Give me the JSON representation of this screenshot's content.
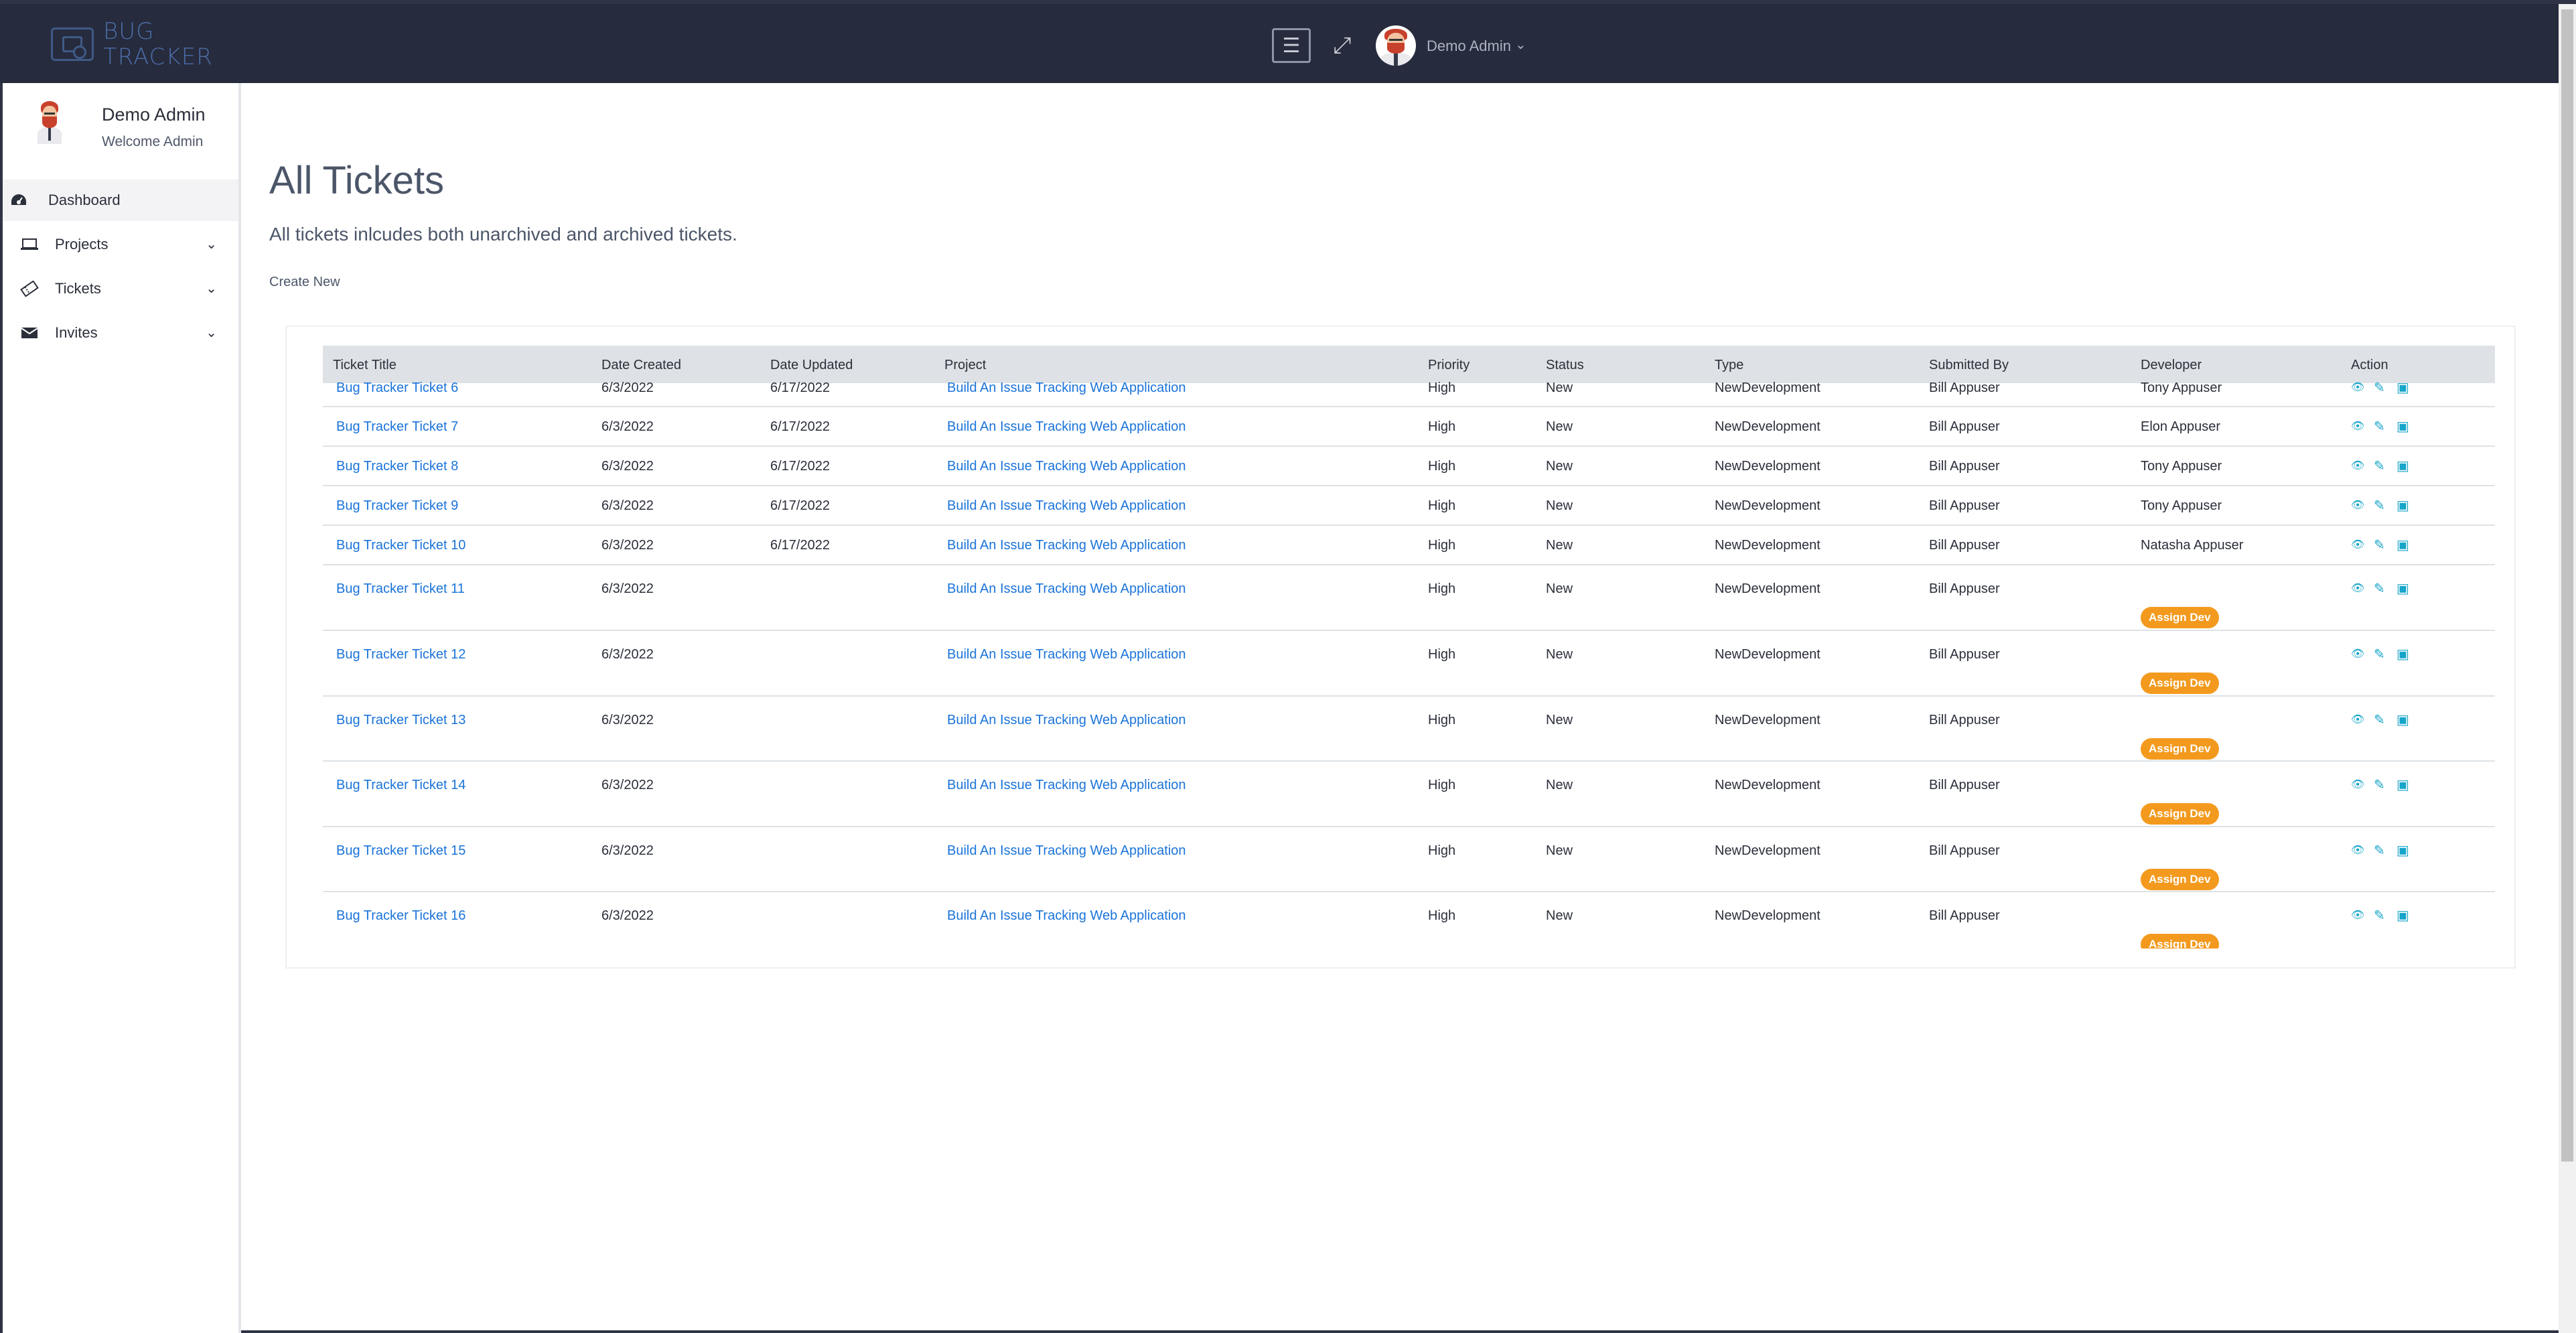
{
  "brand": {
    "line1": "BUG",
    "line2": "TRACKER"
  },
  "topbar": {
    "menu_icon": "hamburger-icon",
    "expand_icon": "expand-icon",
    "user": "Demo Admin",
    "caret": "⌄"
  },
  "sidebar": {
    "user_name": "Demo Admin",
    "welcome": "Welcome Admin",
    "items": [
      {
        "label": "Dashboard",
        "icon": "dashboard-icon",
        "active": true
      },
      {
        "label": "Projects",
        "icon": "laptop-icon"
      },
      {
        "label": "Tickets",
        "icon": "ticket-icon"
      },
      {
        "label": "Invites",
        "icon": "envelope-icon"
      }
    ]
  },
  "main": {
    "title": "All Tickets",
    "subtitle": "All tickets inlcudes both unarchived and archived tickets.",
    "create_new": "Create New"
  },
  "table": {
    "headers": [
      "Ticket Title",
      "Date Created",
      "Date Updated",
      "Project",
      "Priority",
      "Status",
      "Type",
      "Submitted By",
      "Developer",
      "Action"
    ],
    "assign_label": "Assign Dev",
    "rows": [
      {
        "title": "Bug Tracker Ticket 6",
        "created": "6/3/2022",
        "updated": "6/17/2022",
        "project": "Build An Issue Tracking Web Application",
        "priority": "High",
        "status": "New",
        "type": "NewDevelopment",
        "submitted": "Bill Appuser",
        "developer": "Tony Appuser"
      },
      {
        "title": "Bug Tracker Ticket 7",
        "created": "6/3/2022",
        "updated": "6/17/2022",
        "project": "Build An Issue Tracking Web Application",
        "priority": "High",
        "status": "New",
        "type": "NewDevelopment",
        "submitted": "Bill Appuser",
        "developer": "Elon Appuser"
      },
      {
        "title": "Bug Tracker Ticket 8",
        "created": "6/3/2022",
        "updated": "6/17/2022",
        "project": "Build An Issue Tracking Web Application",
        "priority": "High",
        "status": "New",
        "type": "NewDevelopment",
        "submitted": "Bill Appuser",
        "developer": "Tony Appuser"
      },
      {
        "title": "Bug Tracker Ticket 9",
        "created": "6/3/2022",
        "updated": "6/17/2022",
        "project": "Build An Issue Tracking Web Application",
        "priority": "High",
        "status": "New",
        "type": "NewDevelopment",
        "submitted": "Bill Appuser",
        "developer": "Tony Appuser"
      },
      {
        "title": "Bug Tracker Ticket 10",
        "created": "6/3/2022",
        "updated": "6/17/2022",
        "project": "Build An Issue Tracking Web Application",
        "priority": "High",
        "status": "New",
        "type": "NewDevelopment",
        "submitted": "Bill Appuser",
        "developer": "Natasha Appuser"
      },
      {
        "title": "Bug Tracker Ticket 11",
        "created": "6/3/2022",
        "updated": "",
        "project": "Build An Issue Tracking Web Application",
        "priority": "High",
        "status": "New",
        "type": "NewDevelopment",
        "submitted": "Bill Appuser",
        "developer": ""
      },
      {
        "title": "Bug Tracker Ticket 12",
        "created": "6/3/2022",
        "updated": "",
        "project": "Build An Issue Tracking Web Application",
        "priority": "High",
        "status": "New",
        "type": "NewDevelopment",
        "submitted": "Bill Appuser",
        "developer": ""
      },
      {
        "title": "Bug Tracker Ticket 13",
        "created": "6/3/2022",
        "updated": "",
        "project": "Build An Issue Tracking Web Application",
        "priority": "High",
        "status": "New",
        "type": "NewDevelopment",
        "submitted": "Bill Appuser",
        "developer": ""
      },
      {
        "title": "Bug Tracker Ticket 14",
        "created": "6/3/2022",
        "updated": "",
        "project": "Build An Issue Tracking Web Application",
        "priority": "High",
        "status": "New",
        "type": "NewDevelopment",
        "submitted": "Bill Appuser",
        "developer": ""
      },
      {
        "title": "Bug Tracker Ticket 15",
        "created": "6/3/2022",
        "updated": "",
        "project": "Build An Issue Tracking Web Application",
        "priority": "High",
        "status": "New",
        "type": "NewDevelopment",
        "submitted": "Bill Appuser",
        "developer": ""
      },
      {
        "title": "Bug Tracker Ticket 16",
        "created": "6/3/2022",
        "updated": "",
        "project": "Build An Issue Tracking Web Application",
        "priority": "High",
        "status": "New",
        "type": "NewDevelopment",
        "submitted": "Bill Appuser",
        "developer": ""
      }
    ]
  },
  "colors": {
    "topbar": "#262b3d",
    "link": "#1a73d9",
    "assign": "#f39a1e",
    "action": "#17a5c9"
  }
}
